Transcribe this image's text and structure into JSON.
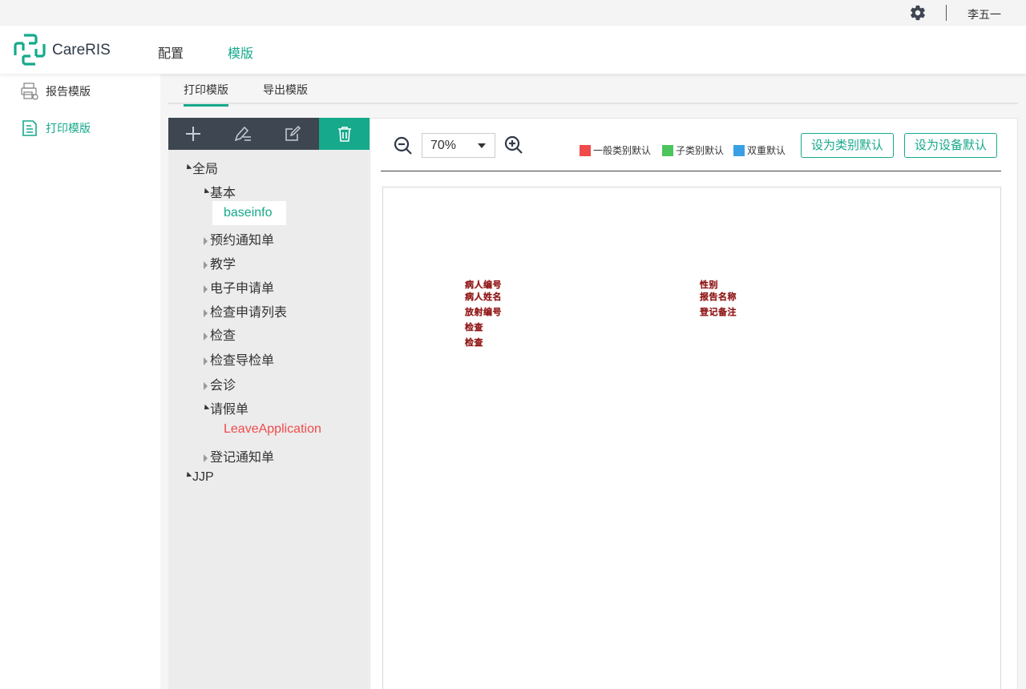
{
  "topbar": {
    "username": "李五一",
    "settings_icon": "gear-icon"
  },
  "header": {
    "logo_text": "CareRIS",
    "nav": [
      {
        "label": "配置"
      },
      {
        "label": "模版"
      }
    ],
    "active_nav": "模版"
  },
  "sidebar": {
    "items": [
      {
        "label": "报告模版",
        "icon": "printer-gear-icon"
      },
      {
        "label": "打印模版",
        "icon": "edit-document-icon"
      }
    ],
    "active": "打印模版"
  },
  "tabs": [
    {
      "label": "打印模版"
    },
    {
      "label": "导出模版"
    }
  ],
  "tree": {
    "toolbar": [
      "plus-icon",
      "pen-lines-icon",
      "edit-box-icon",
      "trash-icon"
    ],
    "nodes": {
      "root1": "全局",
      "basic": "基本",
      "baseinfo": "baseinfo",
      "appointment": "预约通知单",
      "teaching": "教学",
      "e_application": "电子申请单",
      "exam_app_list": "检查申请列表",
      "exam": "检查",
      "exam_guide": "检查导检单",
      "consultation": "会诊",
      "leave": "请假单",
      "leave_app": "LeaveApplication",
      "registration_notice": "登记通知单",
      "root2": "JJP"
    }
  },
  "main": {
    "zoom": {
      "value": "70%"
    },
    "legend": [
      {
        "label": "一般类别默认",
        "color": "#f04a4a"
      },
      {
        "label": "子类别默认",
        "color": "#4cc55c"
      },
      {
        "label": "双重默认",
        "color": "#3aa0e6"
      }
    ],
    "buttons": {
      "set_category_default": "设为类别默认",
      "set_device_default": "设为设备默认"
    },
    "fields": {
      "patient_id": "病人编号",
      "patient_name": "病人姓名",
      "radiology_id": "放射编号",
      "exam1": "检查",
      "exam2": "检查",
      "gender": "性别",
      "report_name": "报告名称",
      "registration_note": "登记备注"
    }
  }
}
